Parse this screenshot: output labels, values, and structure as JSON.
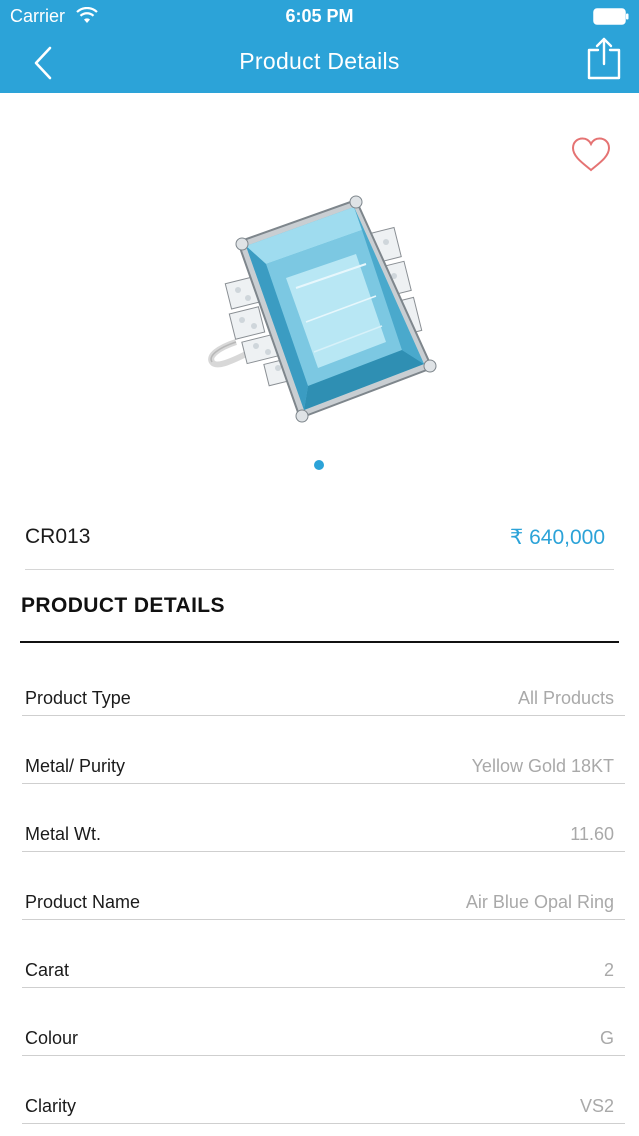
{
  "status_bar": {
    "carrier": "Carrier",
    "time": "6:05 PM"
  },
  "header": {
    "title": "Product Details",
    "back_icon": "chevron-left-icon",
    "share_icon": "share-icon"
  },
  "product": {
    "code": "CR013",
    "price": "₹ 640,000",
    "favorite_icon": "heart-outline-icon",
    "image_pages": 1,
    "current_image": 1
  },
  "details": {
    "heading": "PRODUCT DETAILS",
    "rows": [
      {
        "label": "Product Type",
        "value": "All Products"
      },
      {
        "label": "Metal/ Purity",
        "value": "Yellow Gold 18KT"
      },
      {
        "label": "Metal Wt.",
        "value": "11.60"
      },
      {
        "label": "Product Name",
        "value": "Air Blue Opal Ring"
      },
      {
        "label": "Carat",
        "value": "2"
      },
      {
        "label": "Colour",
        "value": "G"
      },
      {
        "label": "Clarity",
        "value": "VS2"
      }
    ]
  },
  "colors": {
    "accent": "#2ca3d8",
    "favorite": "#e57373",
    "muted_text": "#a9a9a9"
  }
}
